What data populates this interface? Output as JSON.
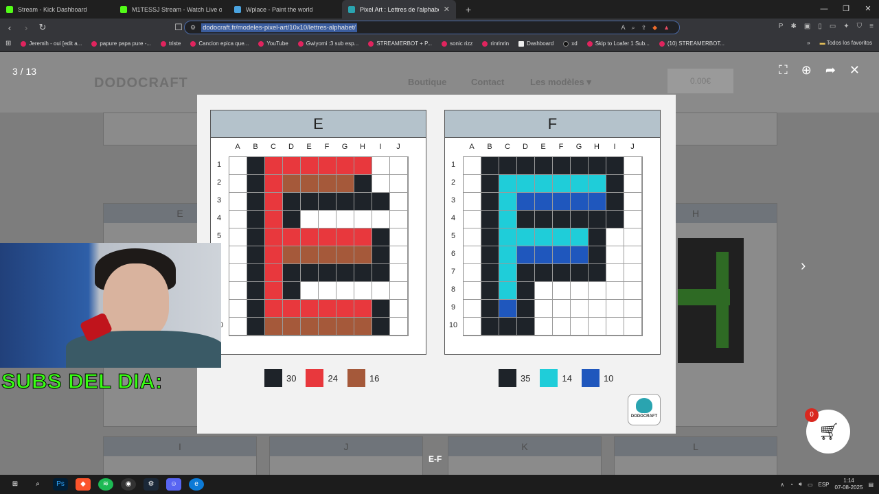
{
  "browser": {
    "tabs": [
      {
        "title": "Stream - Kick Dashboard",
        "color": "#53fc18",
        "active": false
      },
      {
        "title": "M1TESSJ Stream - Watch Live on",
        "color": "#53fc18",
        "active": false
      },
      {
        "title": "Wplace - Paint the world",
        "color": "#4aa3df",
        "active": false
      },
      {
        "title": "Pixel Art : Lettres de l'alphabet -",
        "color": "#2aa4b0",
        "active": true
      }
    ],
    "new_tab_symbol": "+",
    "url": "dodocraft.fr/modeles-pixel-art/10x10/lettres-alphabet/",
    "bookmarks": [
      {
        "label": "Jeremih - oui [edit a...",
        "kind": "yt"
      },
      {
        "label": "papure papa pure -...",
        "kind": "yt"
      },
      {
        "label": "triste",
        "kind": "yt"
      },
      {
        "label": "Cancion epica que...",
        "kind": "yt"
      },
      {
        "label": "YouTube",
        "kind": "yt"
      },
      {
        "label": "Gwiyomi :3 sub esp...",
        "kind": "yt"
      },
      {
        "label": "STREAMERBOT + P...",
        "kind": "yt"
      },
      {
        "label": "sonic rizz",
        "kind": "yt"
      },
      {
        "label": "rinrinrin",
        "kind": "yt"
      },
      {
        "label": "Dashboard",
        "kind": "h"
      },
      {
        "label": "xd",
        "kind": "t"
      },
      {
        "label": "Skip to Loafer 1 Sub...",
        "kind": "yt"
      },
      {
        "label": "(10) STREAMERBOT...",
        "kind": "yt"
      }
    ],
    "bookmarks_folder": "Todos los favoritos"
  },
  "site": {
    "logo": "DODOCRAFT",
    "nav": [
      "Boutique",
      "Contact",
      "Les modèles"
    ],
    "cart_total": "0.00€",
    "cart_count": "0",
    "bg_cards": [
      "E",
      "H",
      "I",
      "J",
      "K",
      "L"
    ]
  },
  "lightbox": {
    "counter": "3 / 13",
    "caption": "E-F",
    "logo_text": "DODOCRAFT"
  },
  "palette": {
    "X": "#1e2329",
    "R": "#e8383d",
    "B": "#a5593a",
    "W": "#ffffff",
    "C": "#1fcdd9",
    "N": "#1f57bd"
  },
  "columns": [
    "A",
    "B",
    "C",
    "D",
    "E",
    "F",
    "G",
    "H",
    "I",
    "J"
  ],
  "rows": [
    "1",
    "2",
    "3",
    "4",
    "5",
    "6",
    "7",
    "8",
    "9",
    "10"
  ],
  "panels": [
    {
      "letter": "E",
      "grid": [
        "WXRRRRRRWW",
        "WXRBBBBXWW",
        "WXRXXXXXXW",
        "WXRXWWWWWW",
        "WXRRRRRRXW",
        "WXRBBBBBXW",
        "WXRXXXXXXW",
        "WXRXWWWWWW",
        "WXRRRRRRXW",
        "WXBBBBBBXW"
      ],
      "legend": [
        {
          "color": "#1e2329",
          "count": "30"
        },
        {
          "color": "#e8383d",
          "count": "24"
        },
        {
          "color": "#a5593a",
          "count": "16"
        }
      ]
    },
    {
      "letter": "F",
      "grid": [
        "WXXXXXXXXW",
        "WXCCCCCCXW",
        "WXCNNNNNXW",
        "WXCXXXXXXW",
        "WXCCCCCXWW",
        "WXCNNNNXWW",
        "WXCXXXXXWW",
        "WXCXWWWWWW",
        "WXNXWWWWWW",
        "WXXXWWWWWW"
      ],
      "legend": [
        {
          "color": "#1e2329",
          "count": "35"
        },
        {
          "color": "#1fcdd9",
          "count": "14"
        },
        {
          "color": "#1f57bd",
          "count": "10"
        }
      ]
    }
  ],
  "overlay": {
    "subs_text": "SUBS DEL DIA:"
  },
  "taskbar": {
    "lang": "ESP",
    "time": "1:14",
    "date": "07-08-2025"
  }
}
